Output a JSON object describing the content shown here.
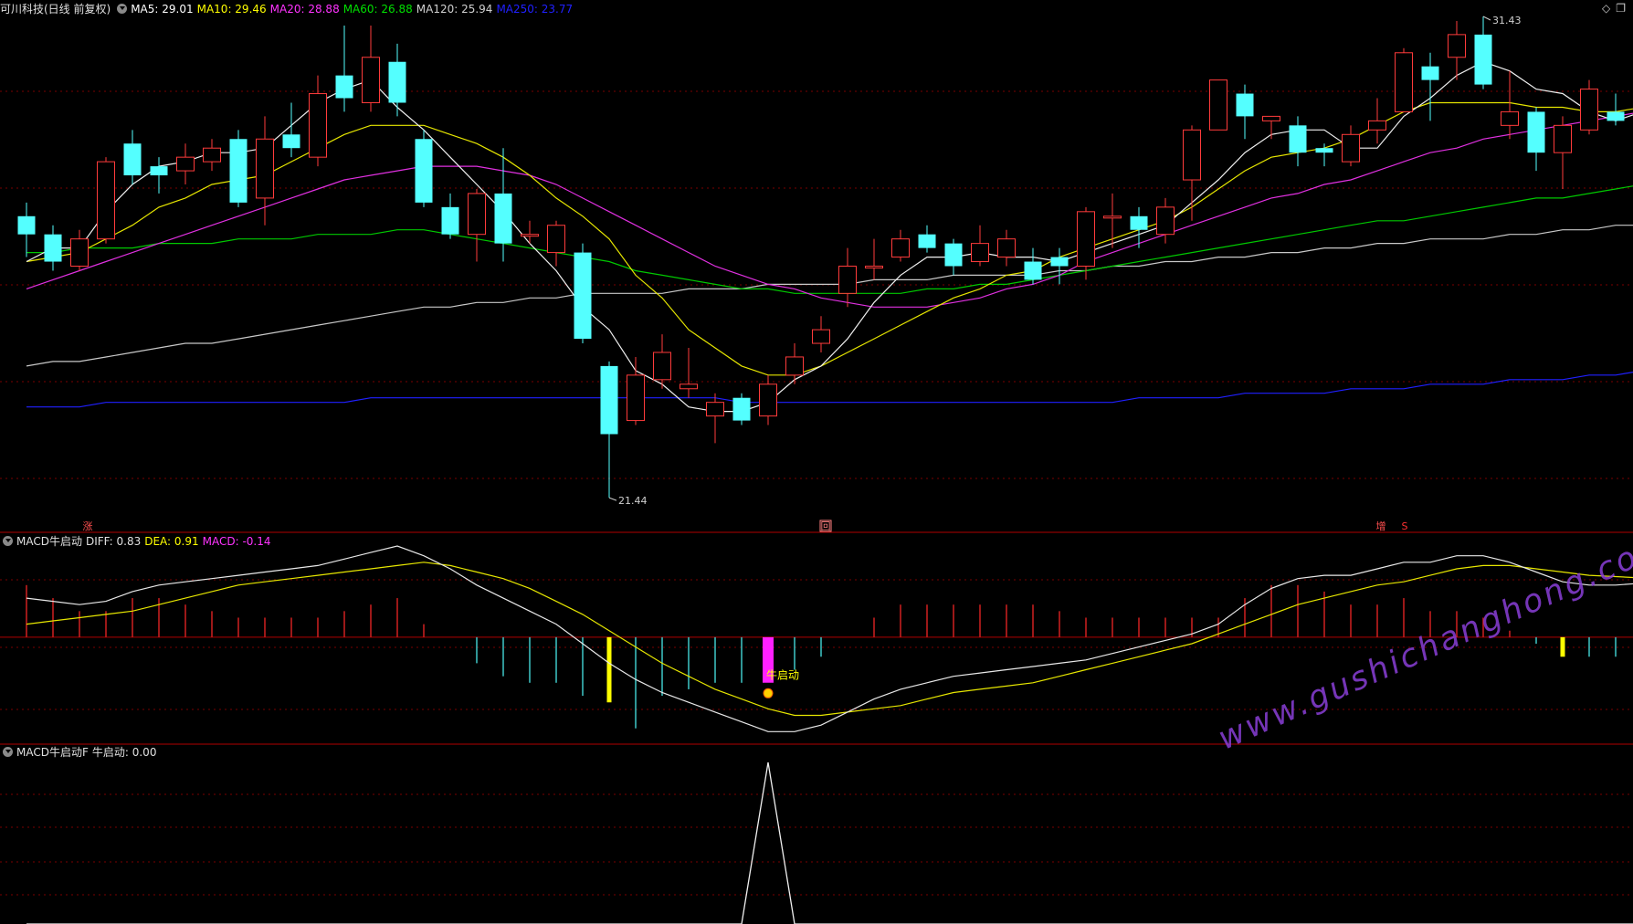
{
  "header": {
    "title": "可川科技(日线 前复权)",
    "ma": [
      {
        "label": "MA5: 29.01",
        "color": "#ffffff"
      },
      {
        "label": "MA10: 29.46",
        "color": "#ffff00"
      },
      {
        "label": "MA20: 28.88",
        "color": "#ff33ff"
      },
      {
        "label": "MA60: 26.88",
        "color": "#00e000"
      },
      {
        "label": "MA120: 25.94",
        "color": "#d0d0d0"
      },
      {
        "label": "MA250: 23.77",
        "color": "#2020ff"
      }
    ]
  },
  "panel2": {
    "name": "MACD牛启动",
    "diff": "DIFF: 0.83",
    "dea": "DEA: 0.91",
    "macd": "MACD: -0.14",
    "signal_label": "牛启动"
  },
  "panel3": {
    "name": "MACD牛启动F",
    "value": "牛启动: 0.00"
  },
  "markers": {
    "zhang": "涨",
    "hui": "回",
    "zeng": "增",
    "s": "S"
  },
  "watermark": "www.gushichanghong.com",
  "chart_data": {
    "type": "candlestick",
    "price_range": [
      21.0,
      32.0
    ],
    "max_label": "31.43",
    "min_label": "21.44",
    "candles": [
      [
        27.6,
        27.2,
        27.9,
        26.7
      ],
      [
        27.2,
        26.6,
        27.4,
        26.4
      ],
      [
        26.5,
        27.1,
        27.3,
        26.4
      ],
      [
        27.1,
        28.8,
        28.9,
        27.0
      ],
      [
        29.2,
        28.5,
        29.5,
        28.3
      ],
      [
        28.7,
        28.5,
        28.9,
        28.1
      ],
      [
        28.6,
        28.9,
        29.2,
        28.3
      ],
      [
        28.8,
        29.1,
        29.3,
        28.6
      ],
      [
        29.3,
        27.9,
        29.5,
        27.8
      ],
      [
        28.0,
        29.3,
        29.8,
        27.4
      ],
      [
        29.4,
        29.1,
        30.1,
        28.9
      ],
      [
        28.9,
        30.3,
        30.7,
        28.7
      ],
      [
        30.7,
        30.2,
        31.8,
        29.9
      ],
      [
        30.1,
        31.1,
        31.8,
        29.9
      ],
      [
        31.0,
        30.1,
        31.4,
        29.8
      ],
      [
        29.3,
        27.9,
        29.5,
        27.8
      ],
      [
        27.8,
        27.2,
        28.1,
        27.1
      ],
      [
        27.2,
        28.1,
        28.2,
        26.6
      ],
      [
        28.1,
        27.0,
        29.1,
        26.6
      ],
      [
        27.2,
        27.2,
        27.5,
        27.0
      ],
      [
        26.8,
        27.4,
        27.5,
        26.5
      ],
      [
        26.8,
        24.9,
        27.0,
        24.8
      ],
      [
        24.3,
        22.8,
        24.4,
        21.4
      ],
      [
        23.1,
        24.1,
        24.5,
        23.0
      ],
      [
        24.0,
        24.6,
        25.0,
        23.8
      ],
      [
        23.8,
        23.9,
        24.7,
        23.6
      ],
      [
        23.2,
        23.5,
        23.7,
        22.6
      ],
      [
        23.6,
        23.1,
        23.7,
        23.0
      ],
      [
        23.2,
        23.9,
        24.1,
        23.0
      ],
      [
        24.1,
        24.5,
        24.8,
        23.9
      ],
      [
        24.8,
        25.1,
        25.4,
        24.6
      ],
      [
        25.9,
        26.5,
        26.9,
        25.6
      ],
      [
        26.5,
        26.5,
        27.1,
        26.2
      ],
      [
        26.7,
        27.1,
        27.3,
        26.6
      ],
      [
        27.2,
        26.9,
        27.4,
        26.8
      ],
      [
        27.0,
        26.5,
        27.1,
        26.3
      ],
      [
        26.6,
        27.0,
        27.4,
        26.5
      ],
      [
        26.7,
        27.1,
        27.3,
        26.5
      ],
      [
        26.6,
        26.2,
        26.9,
        26.1
      ],
      [
        26.7,
        26.5,
        26.9,
        26.1
      ],
      [
        26.5,
        27.7,
        27.8,
        26.2
      ],
      [
        27.6,
        27.6,
        28.1,
        26.9
      ],
      [
        27.6,
        27.3,
        27.8,
        26.9
      ],
      [
        27.2,
        27.8,
        28.0,
        27.0
      ],
      [
        28.4,
        29.5,
        29.6,
        27.5
      ],
      [
        29.5,
        30.6,
        30.6,
        29.5
      ],
      [
        30.3,
        29.8,
        30.5,
        29.3
      ],
      [
        29.7,
        29.8,
        29.8,
        29.3
      ],
      [
        29.6,
        29.0,
        29.8,
        28.7
      ],
      [
        29.1,
        29.0,
        29.2,
        28.7
      ],
      [
        28.8,
        29.4,
        29.6,
        28.7
      ],
      [
        29.5,
        29.7,
        30.2,
        29.2
      ],
      [
        29.9,
        31.2,
        31.3,
        29.9
      ],
      [
        30.9,
        30.6,
        31.2,
        29.7
      ],
      [
        31.1,
        31.6,
        31.9,
        30.6
      ],
      [
        31.6,
        30.5,
        32.0,
        30.4
      ],
      [
        29.6,
        29.9,
        30.8,
        29.3
      ],
      [
        29.9,
        29.0,
        30.0,
        28.6
      ],
      [
        29.0,
        29.6,
        29.8,
        28.2
      ],
      [
        29.5,
        30.4,
        30.6,
        29.4
      ],
      [
        29.9,
        29.7,
        30.3,
        29.6
      ],
      [
        29.2,
        31.0,
        31.3,
        29.0
      ]
    ],
    "ma5": [
      26.6,
      26.9,
      26.9,
      27.7,
      28.3,
      28.7,
      28.8,
      29.0,
      29.0,
      29.1,
      29.6,
      30.1,
      30.4,
      30.6,
      30.0,
      29.5,
      28.9,
      28.3,
      27.7,
      27.0,
      26.4,
      25.6,
      25.1,
      24.2,
      23.9,
      23.4,
      23.3,
      23.3,
      23.5,
      24.0,
      24.3,
      24.9,
      25.7,
      26.3,
      26.7,
      26.7,
      26.8,
      26.7,
      26.7,
      26.6,
      26.8,
      27.0,
      27.2,
      27.4,
      27.9,
      28.4,
      29.0,
      29.4,
      29.5,
      29.5,
      29.1,
      29.1,
      29.8,
      30.2,
      30.7,
      31.0,
      30.8,
      30.4,
      30.3,
      29.9,
      29.7,
      29.9
    ],
    "ma10": [
      26.6,
      26.7,
      26.8,
      27.1,
      27.4,
      27.8,
      28.0,
      28.3,
      28.4,
      28.5,
      28.8,
      29.1,
      29.4,
      29.6,
      29.6,
      29.6,
      29.4,
      29.2,
      28.9,
      28.5,
      28.0,
      27.6,
      27.1,
      26.3,
      25.8,
      25.1,
      24.7,
      24.3,
      24.1,
      24.1,
      24.3,
      24.6,
      24.9,
      25.2,
      25.5,
      25.8,
      26.0,
      26.3,
      26.4,
      26.7,
      26.9,
      27.1,
      27.3,
      27.5,
      27.8,
      28.2,
      28.6,
      28.9,
      29.0,
      29.1,
      29.3,
      29.6,
      29.9,
      30.1,
      30.1,
      30.1,
      30.1,
      30.0,
      30.0,
      29.9,
      29.9,
      30.0
    ],
    "ma20": [
      26.0,
      26.2,
      26.4,
      26.6,
      26.8,
      27.0,
      27.2,
      27.4,
      27.6,
      27.8,
      28.0,
      28.2,
      28.4,
      28.5,
      28.6,
      28.7,
      28.7,
      28.7,
      28.6,
      28.5,
      28.3,
      28.0,
      27.7,
      27.4,
      27.1,
      26.8,
      26.5,
      26.3,
      26.1,
      26.0,
      25.8,
      25.7,
      25.6,
      25.6,
      25.6,
      25.7,
      25.8,
      26.0,
      26.1,
      26.3,
      26.6,
      26.8,
      27.0,
      27.2,
      27.4,
      27.6,
      27.8,
      28.0,
      28.1,
      28.3,
      28.4,
      28.6,
      28.8,
      29.0,
      29.1,
      29.3,
      29.4,
      29.5,
      29.6,
      29.7,
      29.8,
      29.9
    ],
    "ma60": [
      26.8,
      26.8,
      26.9,
      26.9,
      26.9,
      27.0,
      27.0,
      27.0,
      27.1,
      27.1,
      27.1,
      27.2,
      27.2,
      27.2,
      27.3,
      27.3,
      27.2,
      27.1,
      27.0,
      26.9,
      26.8,
      26.7,
      26.6,
      26.4,
      26.3,
      26.2,
      26.1,
      26.0,
      26.0,
      25.9,
      25.9,
      25.9,
      25.9,
      25.9,
      26.0,
      26.0,
      26.1,
      26.1,
      26.2,
      26.3,
      26.4,
      26.5,
      26.6,
      26.7,
      26.8,
      26.9,
      27.0,
      27.1,
      27.2,
      27.3,
      27.4,
      27.5,
      27.5,
      27.6,
      27.7,
      27.8,
      27.9,
      28.0,
      28.0,
      28.1,
      28.2,
      28.3
    ],
    "ma120": [
      24.3,
      24.4,
      24.4,
      24.5,
      24.6,
      24.7,
      24.8,
      24.8,
      24.9,
      25.0,
      25.1,
      25.2,
      25.3,
      25.4,
      25.5,
      25.6,
      25.6,
      25.7,
      25.7,
      25.8,
      25.8,
      25.9,
      25.9,
      25.9,
      25.9,
      26.0,
      26.0,
      26.0,
      26.1,
      26.1,
      26.1,
      26.1,
      26.2,
      26.2,
      26.2,
      26.3,
      26.3,
      26.3,
      26.3,
      26.4,
      26.4,
      26.5,
      26.5,
      26.6,
      26.6,
      26.7,
      26.7,
      26.8,
      26.8,
      26.9,
      26.9,
      27.0,
      27.0,
      27.1,
      27.1,
      27.1,
      27.2,
      27.2,
      27.3,
      27.3,
      27.4,
      27.4
    ],
    "ma250": [
      23.4,
      23.4,
      23.4,
      23.5,
      23.5,
      23.5,
      23.5,
      23.5,
      23.5,
      23.5,
      23.5,
      23.5,
      23.5,
      23.6,
      23.6,
      23.6,
      23.6,
      23.6,
      23.6,
      23.6,
      23.6,
      23.6,
      23.6,
      23.6,
      23.6,
      23.6,
      23.6,
      23.5,
      23.5,
      23.5,
      23.5,
      23.5,
      23.5,
      23.5,
      23.5,
      23.5,
      23.5,
      23.5,
      23.5,
      23.5,
      23.5,
      23.5,
      23.6,
      23.6,
      23.6,
      23.6,
      23.7,
      23.7,
      23.7,
      23.7,
      23.8,
      23.8,
      23.8,
      23.9,
      23.9,
      23.9,
      24.0,
      24.0,
      24.0,
      24.1,
      24.1,
      24.2
    ],
    "macd_range": [
      -1.6,
      1.4
    ],
    "diff": [
      0.6,
      0.55,
      0.5,
      0.55,
      0.7,
      0.8,
      0.85,
      0.9,
      0.95,
      1.0,
      1.05,
      1.1,
      1.2,
      1.3,
      1.4,
      1.25,
      1.05,
      0.8,
      0.6,
      0.4,
      0.2,
      -0.1,
      -0.4,
      -0.65,
      -0.85,
      -1.0,
      -1.15,
      -1.3,
      -1.45,
      -1.45,
      -1.35,
      -1.15,
      -0.95,
      -0.8,
      -0.7,
      -0.6,
      -0.55,
      -0.5,
      -0.45,
      -0.4,
      -0.35,
      -0.25,
      -0.15,
      -0.05,
      0.05,
      0.2,
      0.5,
      0.75,
      0.9,
      0.95,
      0.95,
      1.05,
      1.15,
      1.15,
      1.25,
      1.25,
      1.15,
      1.0,
      0.85,
      0.8,
      0.8,
      0.83
    ],
    "dea": [
      0.2,
      0.25,
      0.3,
      0.35,
      0.4,
      0.5,
      0.6,
      0.7,
      0.8,
      0.85,
      0.9,
      0.95,
      1.0,
      1.05,
      1.1,
      1.15,
      1.1,
      1.0,
      0.9,
      0.75,
      0.55,
      0.35,
      0.1,
      -0.15,
      -0.4,
      -0.6,
      -0.8,
      -0.95,
      -1.1,
      -1.2,
      -1.2,
      -1.15,
      -1.1,
      -1.05,
      -0.95,
      -0.85,
      -0.8,
      -0.75,
      -0.7,
      -0.6,
      -0.5,
      -0.4,
      -0.3,
      -0.2,
      -0.1,
      0.05,
      0.2,
      0.35,
      0.5,
      0.6,
      0.7,
      0.8,
      0.85,
      0.95,
      1.05,
      1.1,
      1.1,
      1.05,
      1.0,
      0.95,
      0.93,
      0.91
    ],
    "macd": [
      0.8,
      0.6,
      0.4,
      0.4,
      0.6,
      0.6,
      0.5,
      0.4,
      0.3,
      0.3,
      0.3,
      0.3,
      0.4,
      0.5,
      0.6,
      0.2,
      0,
      -0.4,
      -0.6,
      -0.7,
      -0.7,
      -0.9,
      -1.0,
      -1.4,
      -0.9,
      -0.8,
      -0.7,
      -0.7,
      -0.7,
      -0.5,
      -0.3,
      0,
      0.3,
      0.5,
      0.5,
      0.5,
      0.5,
      0.5,
      0.5,
      0.4,
      0.3,
      0.3,
      0.3,
      0.3,
      0.3,
      0.3,
      0.6,
      0.8,
      0.8,
      0.7,
      0.5,
      0.5,
      0.6,
      0.4,
      0.4,
      0.3,
      0.1,
      -0.1,
      -0.3,
      -0.3,
      -0.3,
      -0.14
    ],
    "signal_index": 28,
    "bull_signal": [
      0,
      0,
      0,
      0,
      0,
      0,
      0,
      0,
      0,
      0,
      0,
      0,
      0,
      0,
      0,
      0,
      0,
      0,
      0,
      0,
      0,
      0,
      0,
      0,
      0,
      0,
      0,
      0,
      1,
      0,
      0,
      0,
      0,
      0,
      0,
      0,
      0,
      0,
      0,
      0,
      0,
      0,
      0,
      0,
      0,
      0,
      0,
      0,
      0,
      0,
      0,
      0,
      0,
      0,
      0,
      0,
      0,
      0,
      0,
      0,
      0,
      0
    ],
    "yellow_bar_indices": [
      22,
      58
    ]
  }
}
